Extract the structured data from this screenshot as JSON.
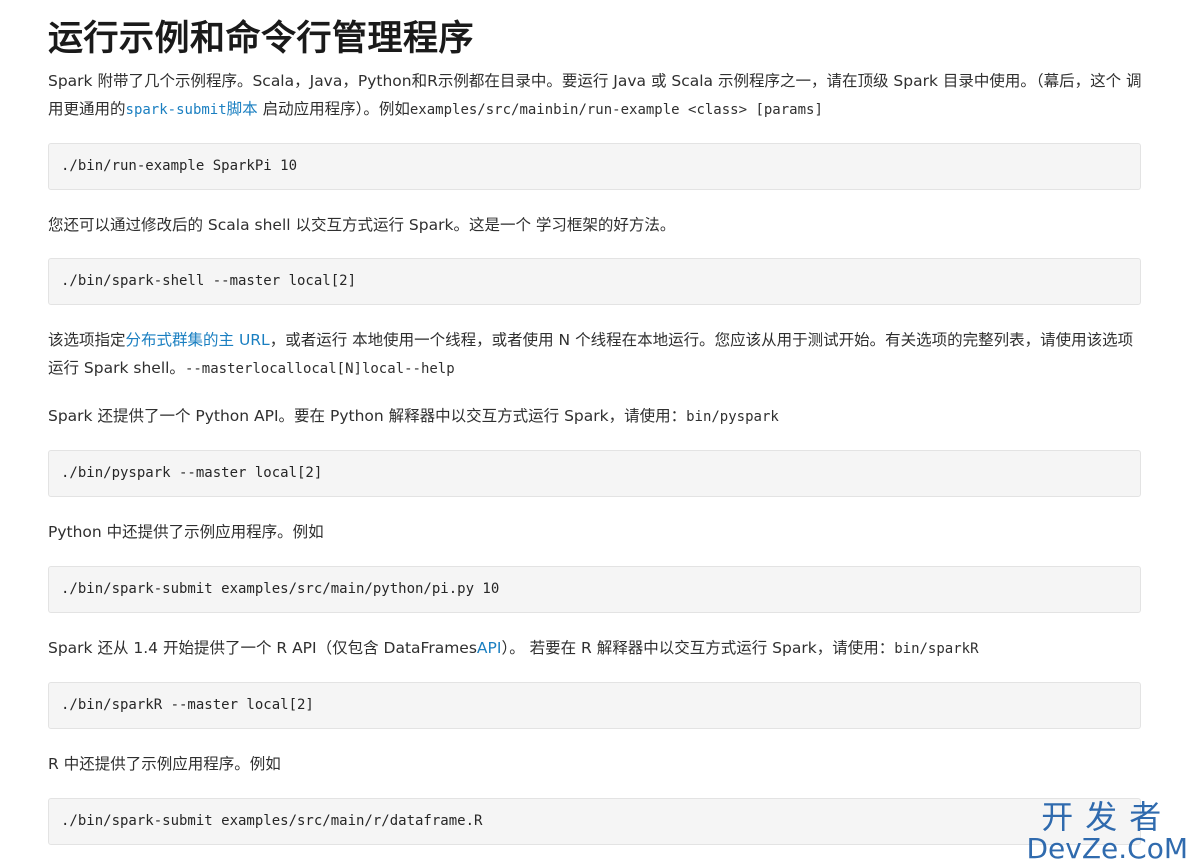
{
  "heading": "运行示例和命令行管理程序",
  "para1": {
    "text_a": "Spark 附带了几个示例程序。Scala，Java，Python和R示例都在目录中。要运行 Java 或 Scala 示例程序之一，请在顶级 Spark 目录中使用。（幕后，这个 调用更通用的",
    "link_code": "spark-submit",
    "link_text": "脚本",
    "text_b": " 启动应用程序）。例如",
    "code": "examples/src/mainbin/run-example <class> [params]"
  },
  "code1": "./bin/run-example SparkPi 10",
  "para2": "您还可以通过修改后的 Scala shell 以交互方式运行 Spark。这是一个 学习框架的好方法。",
  "code2": "./bin/spark-shell --master local[2]",
  "para3": {
    "text_a": "该选项指定",
    "link_text": "分布式群集的主 URL",
    "text_b": "，或者运行 本地使用一个线程，或者使用 N 个线程在本地运行。您应该从用于测试开始。有关选项的完整列表，请使用该选项运行 Spark shell。",
    "code": "--masterlocallocal[N]local--help"
  },
  "para4": {
    "text_a": "Spark 还提供了一个 Python API。要在 Python 解释器中以交互方式运行 Spark，请使用：",
    "code": "bin/pyspark"
  },
  "code3": "./bin/pyspark --master local[2]",
  "para5": "Python 中还提供了示例应用程序。例如",
  "code4": "./bin/spark-submit examples/src/main/python/pi.py 10",
  "para6": {
    "text_a": "Spark 还从 1.4 开始提供了一个 R API（仅包含 DataFrames",
    "link_text": "API",
    "text_b": "）。 若要在 R 解释器中以交互方式运行 Spark，请使用：",
    "code": "bin/sparkR"
  },
  "code5": "./bin/sparkR --master local[2]",
  "para7": "R 中还提供了示例应用程序。例如",
  "code6": "./bin/spark-submit examples/src/main/r/dataframe.R",
  "watermark": {
    "cn": "开发者",
    "en": "DevZe.CoM"
  },
  "colors": {
    "link": "#1a7fc1",
    "code_bg": "#f5f5f5",
    "watermark": "#1f5fa8"
  }
}
